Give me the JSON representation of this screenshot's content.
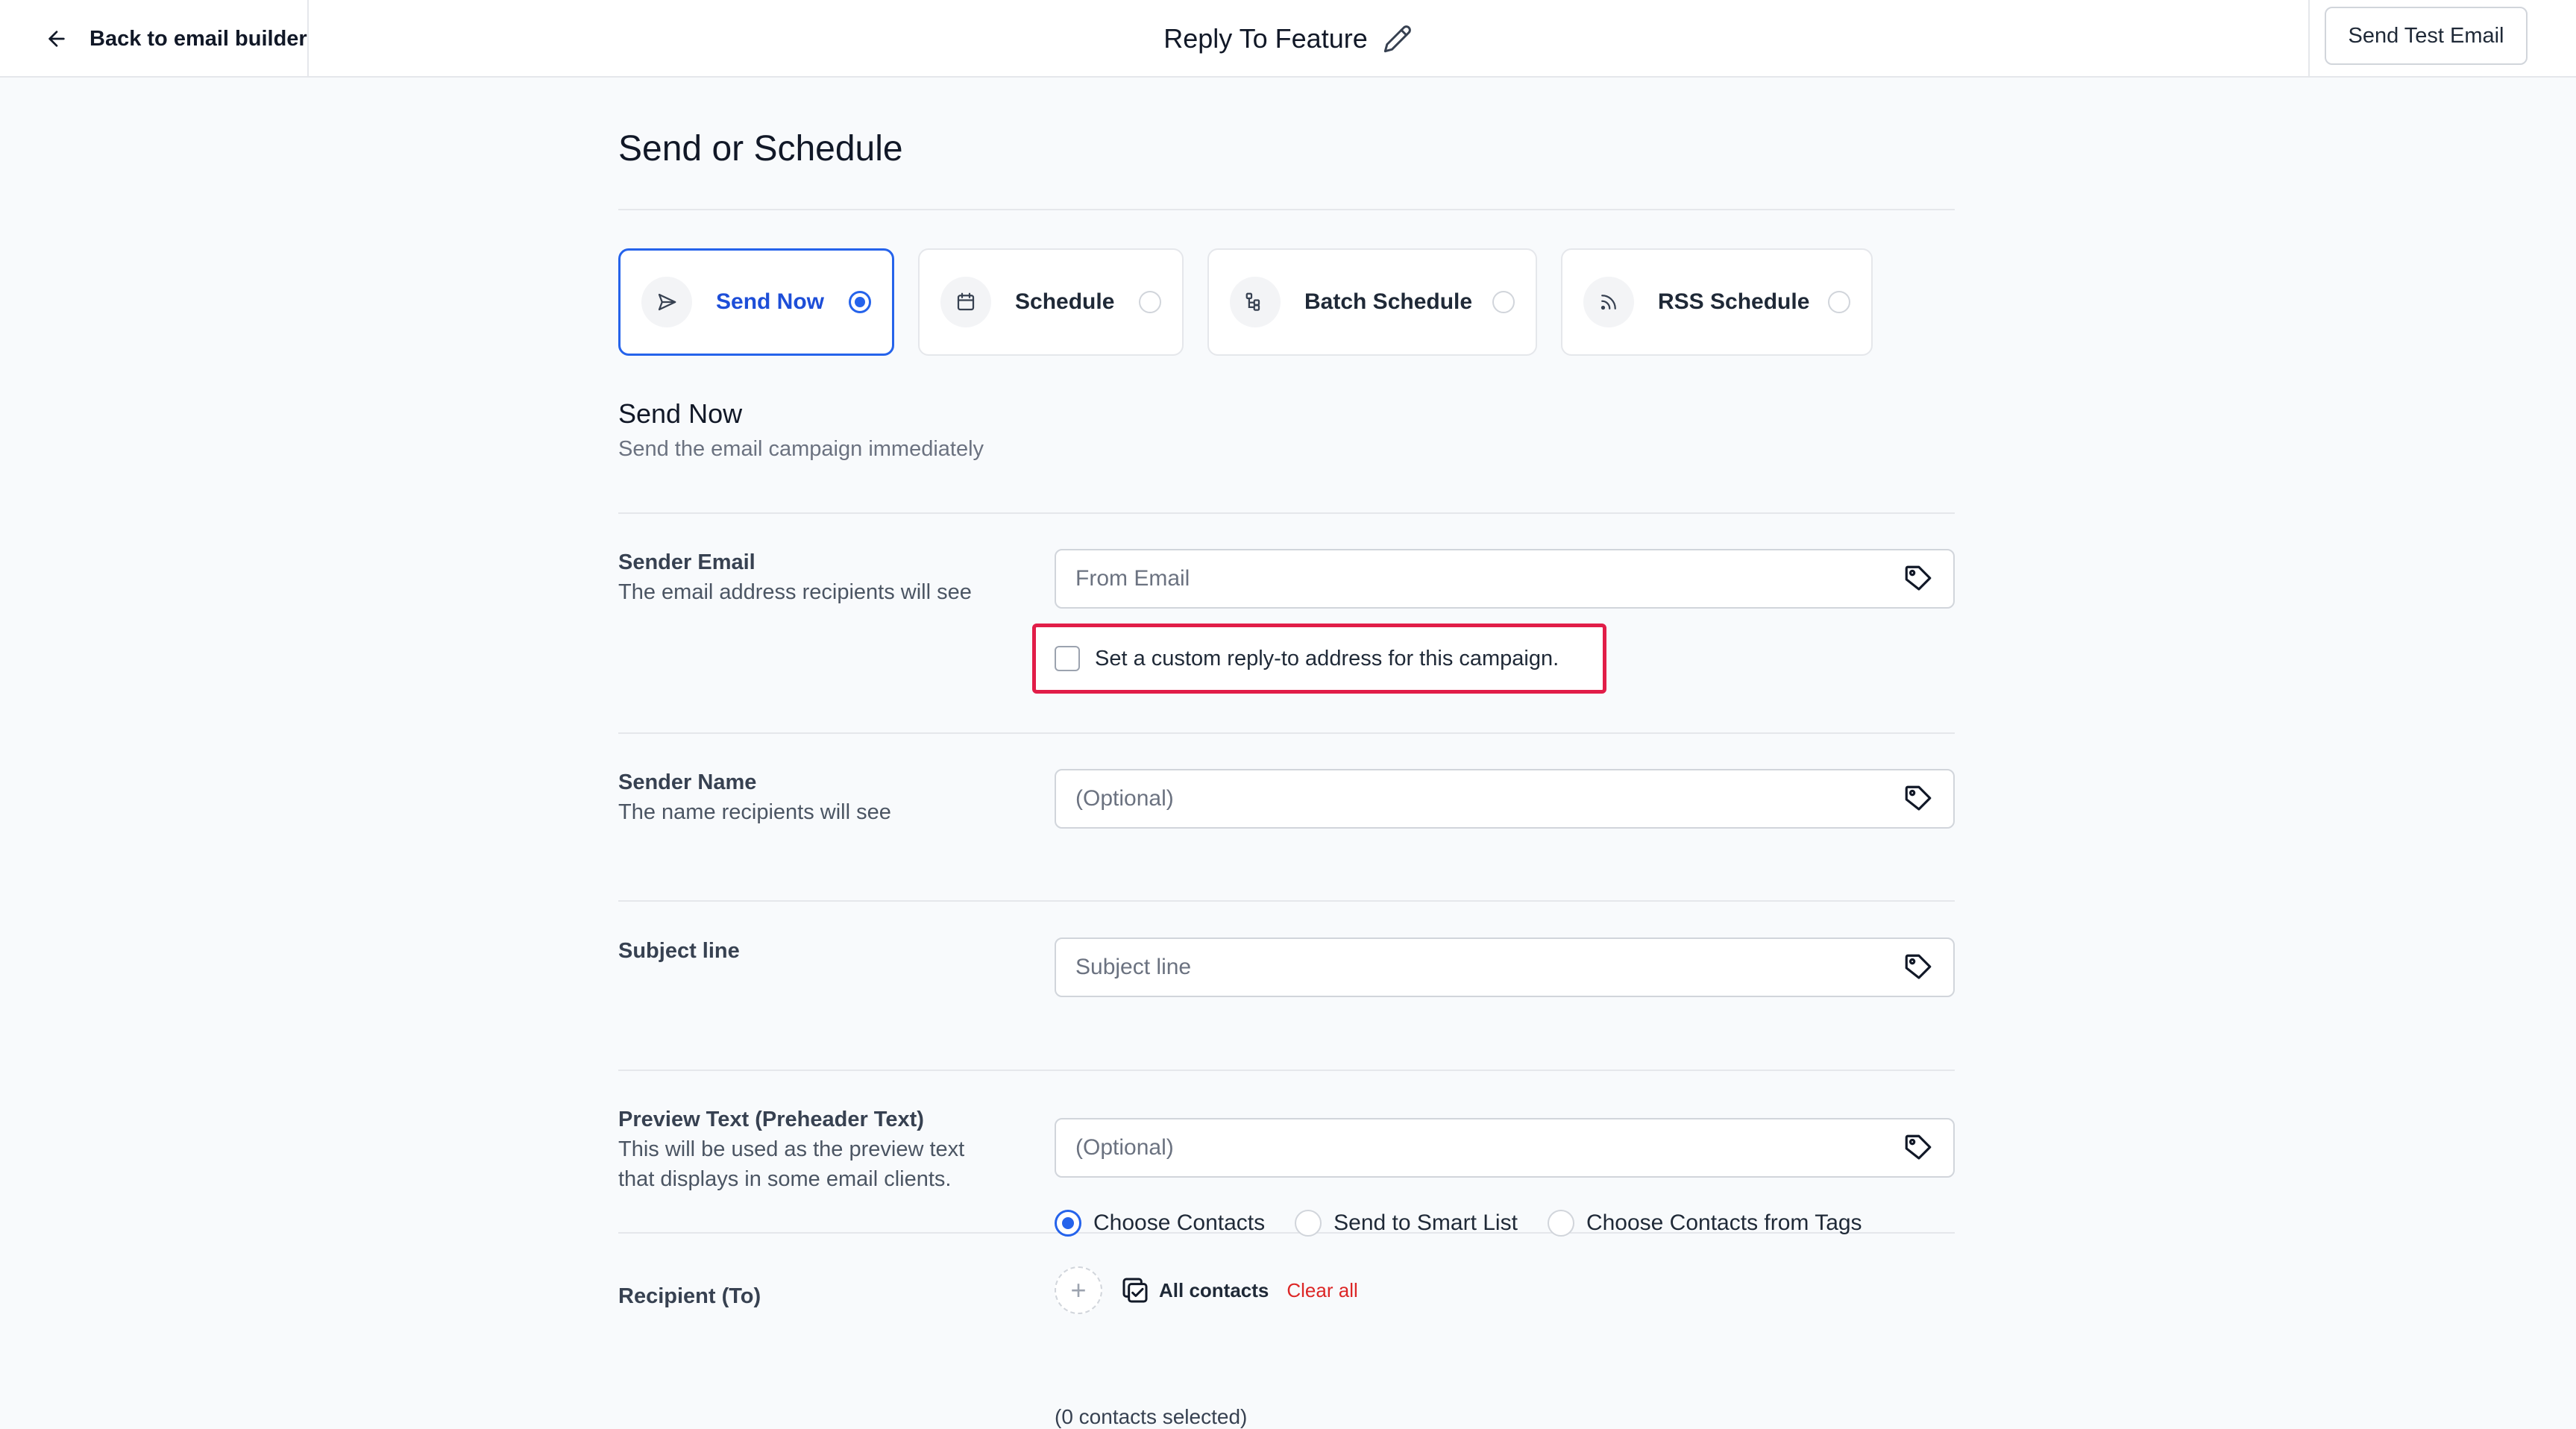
{
  "header": {
    "back_label": "Back to email builder",
    "title": "Reply To Feature",
    "send_test_label": "Send Test Email"
  },
  "page": {
    "title": "Send or Schedule"
  },
  "send_options": [
    {
      "label": "Send Now",
      "icon": "send-icon",
      "selected": true
    },
    {
      "label": "Schedule",
      "icon": "calendar-icon",
      "selected": false
    },
    {
      "label": "Batch Schedule",
      "icon": "batch-icon",
      "selected": false
    },
    {
      "label": "RSS Schedule",
      "icon": "rss-icon",
      "selected": false
    }
  ],
  "section": {
    "title": "Send Now",
    "subtitle": "Send the email campaign immediately"
  },
  "fields": {
    "sender_email": {
      "label": "Sender Email",
      "description": "The email address recipients will see",
      "placeholder": "From Email",
      "value": ""
    },
    "reply_to": {
      "label": "Set a custom reply-to address for this campaign.",
      "checked": false
    },
    "sender_name": {
      "label": "Sender Name",
      "description": "The name recipients will see",
      "placeholder": "(Optional)",
      "value": ""
    },
    "subject": {
      "label": "Subject line",
      "placeholder": "Subject line",
      "value": ""
    },
    "preview": {
      "label": "Preview Text (Preheader Text)",
      "description_line1": "This will be used as the preview text",
      "description_line2": "that displays in some email clients.",
      "placeholder": "(Optional)",
      "value": ""
    }
  },
  "recipient": {
    "label": "Recipient (To)",
    "options": [
      "Choose Contacts",
      "Send to Smart List",
      "Choose Contacts from Tags"
    ],
    "selected_index": 0,
    "all_contacts_label": "All contacts",
    "clear_label": "Clear all",
    "selected_text": "(0 contacts selected)"
  },
  "colors": {
    "accent": "#2563eb",
    "highlight_border": "#e11d48",
    "clear_red": "#dc2626"
  }
}
